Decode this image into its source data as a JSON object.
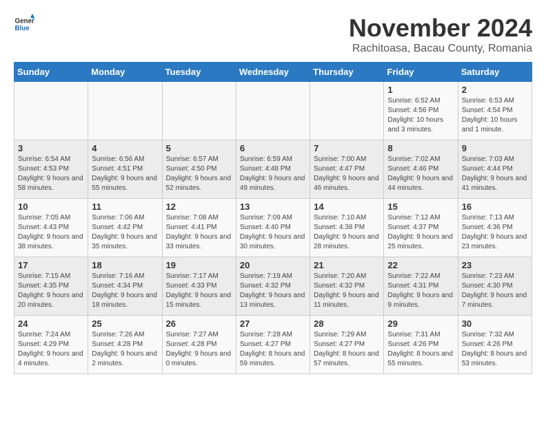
{
  "header": {
    "logo_general": "General",
    "logo_blue": "Blue",
    "month_title": "November 2024",
    "subtitle": "Rachitoasa, Bacau County, Romania"
  },
  "days_of_week": [
    "Sunday",
    "Monday",
    "Tuesday",
    "Wednesday",
    "Thursday",
    "Friday",
    "Saturday"
  ],
  "weeks": [
    [
      {
        "day": "",
        "content": ""
      },
      {
        "day": "",
        "content": ""
      },
      {
        "day": "",
        "content": ""
      },
      {
        "day": "",
        "content": ""
      },
      {
        "day": "",
        "content": ""
      },
      {
        "day": "1",
        "content": "Sunrise: 6:52 AM\nSunset: 4:56 PM\nDaylight: 10 hours and 3 minutes."
      },
      {
        "day": "2",
        "content": "Sunrise: 6:53 AM\nSunset: 4:54 PM\nDaylight: 10 hours and 1 minute."
      }
    ],
    [
      {
        "day": "3",
        "content": "Sunrise: 6:54 AM\nSunset: 4:53 PM\nDaylight: 9 hours and 58 minutes."
      },
      {
        "day": "4",
        "content": "Sunrise: 6:56 AM\nSunset: 4:51 PM\nDaylight: 9 hours and 55 minutes."
      },
      {
        "day": "5",
        "content": "Sunrise: 6:57 AM\nSunset: 4:50 PM\nDaylight: 9 hours and 52 minutes."
      },
      {
        "day": "6",
        "content": "Sunrise: 6:59 AM\nSunset: 4:48 PM\nDaylight: 9 hours and 49 minutes."
      },
      {
        "day": "7",
        "content": "Sunrise: 7:00 AM\nSunset: 4:47 PM\nDaylight: 9 hours and 46 minutes."
      },
      {
        "day": "8",
        "content": "Sunrise: 7:02 AM\nSunset: 4:46 PM\nDaylight: 9 hours and 44 minutes."
      },
      {
        "day": "9",
        "content": "Sunrise: 7:03 AM\nSunset: 4:44 PM\nDaylight: 9 hours and 41 minutes."
      }
    ],
    [
      {
        "day": "10",
        "content": "Sunrise: 7:05 AM\nSunset: 4:43 PM\nDaylight: 9 hours and 38 minutes."
      },
      {
        "day": "11",
        "content": "Sunrise: 7:06 AM\nSunset: 4:42 PM\nDaylight: 9 hours and 35 minutes."
      },
      {
        "day": "12",
        "content": "Sunrise: 7:08 AM\nSunset: 4:41 PM\nDaylight: 9 hours and 33 minutes."
      },
      {
        "day": "13",
        "content": "Sunrise: 7:09 AM\nSunset: 4:40 PM\nDaylight: 9 hours and 30 minutes."
      },
      {
        "day": "14",
        "content": "Sunrise: 7:10 AM\nSunset: 4:38 PM\nDaylight: 9 hours and 28 minutes."
      },
      {
        "day": "15",
        "content": "Sunrise: 7:12 AM\nSunset: 4:37 PM\nDaylight: 9 hours and 25 minutes."
      },
      {
        "day": "16",
        "content": "Sunrise: 7:13 AM\nSunset: 4:36 PM\nDaylight: 9 hours and 23 minutes."
      }
    ],
    [
      {
        "day": "17",
        "content": "Sunrise: 7:15 AM\nSunset: 4:35 PM\nDaylight: 9 hours and 20 minutes."
      },
      {
        "day": "18",
        "content": "Sunrise: 7:16 AM\nSunset: 4:34 PM\nDaylight: 9 hours and 18 minutes."
      },
      {
        "day": "19",
        "content": "Sunrise: 7:17 AM\nSunset: 4:33 PM\nDaylight: 9 hours and 15 minutes."
      },
      {
        "day": "20",
        "content": "Sunrise: 7:19 AM\nSunset: 4:32 PM\nDaylight: 9 hours and 13 minutes."
      },
      {
        "day": "21",
        "content": "Sunrise: 7:20 AM\nSunset: 4:32 PM\nDaylight: 9 hours and 11 minutes."
      },
      {
        "day": "22",
        "content": "Sunrise: 7:22 AM\nSunset: 4:31 PM\nDaylight: 9 hours and 9 minutes."
      },
      {
        "day": "23",
        "content": "Sunrise: 7:23 AM\nSunset: 4:30 PM\nDaylight: 9 hours and 7 minutes."
      }
    ],
    [
      {
        "day": "24",
        "content": "Sunrise: 7:24 AM\nSunset: 4:29 PM\nDaylight: 9 hours and 4 minutes."
      },
      {
        "day": "25",
        "content": "Sunrise: 7:26 AM\nSunset: 4:28 PM\nDaylight: 9 hours and 2 minutes."
      },
      {
        "day": "26",
        "content": "Sunrise: 7:27 AM\nSunset: 4:28 PM\nDaylight: 9 hours and 0 minutes."
      },
      {
        "day": "27",
        "content": "Sunrise: 7:28 AM\nSunset: 4:27 PM\nDaylight: 8 hours and 59 minutes."
      },
      {
        "day": "28",
        "content": "Sunrise: 7:29 AM\nSunset: 4:27 PM\nDaylight: 8 hours and 57 minutes."
      },
      {
        "day": "29",
        "content": "Sunrise: 7:31 AM\nSunset: 4:26 PM\nDaylight: 8 hours and 55 minutes."
      },
      {
        "day": "30",
        "content": "Sunrise: 7:32 AM\nSunset: 4:26 PM\nDaylight: 8 hours and 53 minutes."
      }
    ]
  ]
}
